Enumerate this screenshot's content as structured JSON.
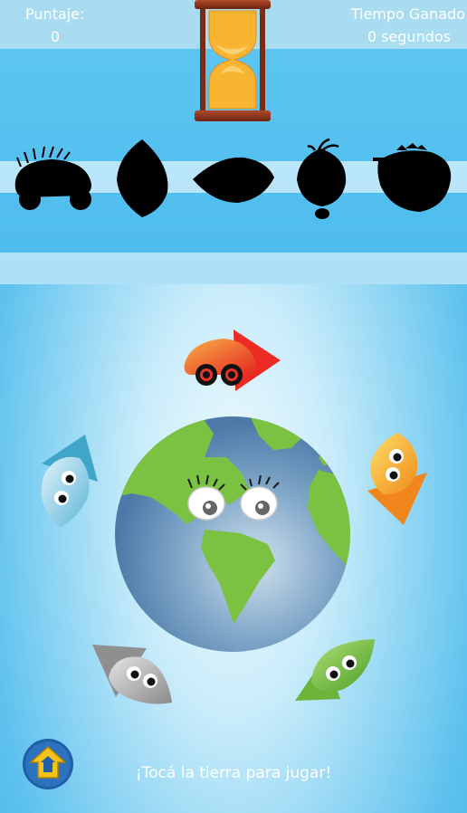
{
  "hud": {
    "score_label": "Puntaje:",
    "score_value": "0",
    "time_label": "Tiempo Ganado",
    "time_value": "0 segundos"
  },
  "silhouettes": [
    "car-silhouette",
    "leaf-silhouette",
    "drop-silhouette",
    "onion-silhouette",
    "strawberry-silhouette"
  ],
  "creatures": [
    "red-car-creature",
    "orange-creature",
    "green-creature",
    "gray-creature",
    "blue-creature"
  ],
  "hint": "¡Tocá la tierra para jugar!",
  "colors": {
    "sky": "#4cbbed",
    "red": "#e8352a",
    "orange": "#f5a21c",
    "green": "#7cc242",
    "gray": "#9a9a9a",
    "cyan": "#6fc3dd",
    "home_blue": "#1f5fa8",
    "home_yellow": "#f6c218"
  }
}
